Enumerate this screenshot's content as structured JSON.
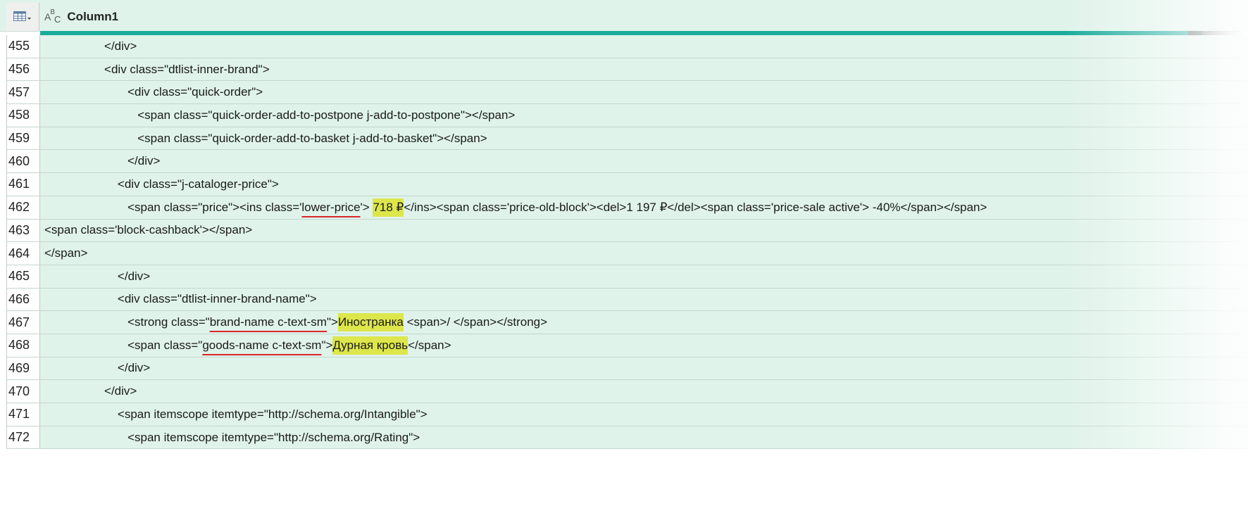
{
  "header": {
    "table_icon": "table-icon",
    "type_icon": "text-type-icon",
    "type_icon_parts": [
      "A",
      "B",
      "C"
    ],
    "column_title": "Column1"
  },
  "rows": [
    {
      "num": "455",
      "indent": "                  ",
      "parts": [
        {
          "t": "</div>"
        }
      ]
    },
    {
      "num": "456",
      "indent": "                  ",
      "parts": [
        {
          "t": "<div class=\"dtlist-inner-brand\">"
        }
      ]
    },
    {
      "num": "457",
      "indent": "                         ",
      "parts": [
        {
          "t": "<div class=\"quick-order\">"
        }
      ]
    },
    {
      "num": "458",
      "indent": "                            ",
      "parts": [
        {
          "t": "<span class=\"quick-order-add-to-postpone j-add-to-postpone\"></span>"
        }
      ]
    },
    {
      "num": "459",
      "indent": "                            ",
      "parts": [
        {
          "t": "<span class=\"quick-order-add-to-basket j-add-to-basket\"></span>"
        }
      ]
    },
    {
      "num": "460",
      "indent": "                         ",
      "parts": [
        {
          "t": "</div>"
        }
      ]
    },
    {
      "num": "461",
      "indent": "                      ",
      "parts": [
        {
          "t": "<div class=\"j-cataloger-price\">"
        }
      ]
    },
    {
      "num": "462",
      "indent": "                         ",
      "parts": [
        {
          "t": "<span class=\"price\"><ins class='"
        },
        {
          "t": "lower-price",
          "u": true
        },
        {
          "t": "'"
        },
        {
          "t": "> "
        },
        {
          "t": "718 ₽",
          "h": true
        },
        {
          "t": "</ins><span class='price-old-block'><del>1 197 ₽</del><span class='price-sale active'> -40%</span></span>"
        }
      ]
    },
    {
      "num": "463",
      "indent": "",
      "parts": [
        {
          "t": "<span class='block-cashback'></span>"
        }
      ]
    },
    {
      "num": "464",
      "indent": "",
      "parts": [
        {
          "t": "</span>"
        }
      ]
    },
    {
      "num": "465",
      "indent": "                      ",
      "parts": [
        {
          "t": "</div>"
        }
      ]
    },
    {
      "num": "466",
      "indent": "                      ",
      "parts": [
        {
          "t": "<div class=\"dtlist-inner-brand-name\">"
        }
      ]
    },
    {
      "num": "467",
      "indent": "                         ",
      "parts": [
        {
          "t": "<strong class=\""
        },
        {
          "t": "brand-name c-text-sm",
          "u": true
        },
        {
          "t": "\""
        },
        {
          "t": ">"
        },
        {
          "t": "Иностранка",
          "h": true
        },
        {
          "t": " <span>/ </span></strong>"
        }
      ]
    },
    {
      "num": "468",
      "indent": "                         ",
      "parts": [
        {
          "t": "<span class=\""
        },
        {
          "t": "goods-name c-text-sm",
          "u": true
        },
        {
          "t": "\""
        },
        {
          "t": ">"
        },
        {
          "t": "Дурная кровь",
          "h": true
        },
        {
          "t": "</span>"
        }
      ]
    },
    {
      "num": "469",
      "indent": "                      ",
      "parts": [
        {
          "t": "</div>"
        }
      ]
    },
    {
      "num": "470",
      "indent": "                  ",
      "parts": [
        {
          "t": "</div>"
        }
      ]
    },
    {
      "num": "471",
      "indent": "                      ",
      "parts": [
        {
          "t": "<span itemscope itemtype=\"http://schema.org/Intangible\">"
        }
      ]
    },
    {
      "num": "472",
      "indent": "                         ",
      "parts": [
        {
          "t": "<span itemscope itemtype=\"http://schema.org/Rating\">"
        }
      ]
    }
  ],
  "colors": {
    "cell_bg": "#dff3ea",
    "quality_bar": "#1aab9b",
    "highlight": "#dde64a",
    "underline": "#d9262a"
  }
}
